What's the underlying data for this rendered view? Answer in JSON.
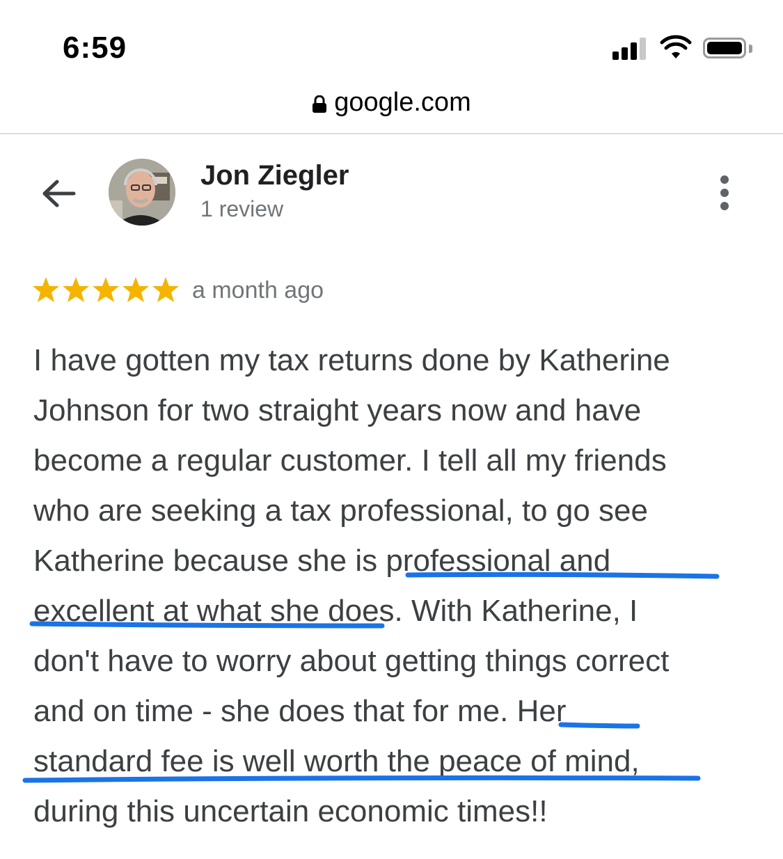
{
  "status_bar": {
    "time": "6:59",
    "icons": [
      "signal-icon",
      "wifi-icon",
      "battery-icon"
    ]
  },
  "browser": {
    "url": "google.com",
    "lock_icon": "lock-icon"
  },
  "reviewer": {
    "name": "Jon Ziegler",
    "review_count": "1 review",
    "avatar": "avatar"
  },
  "review": {
    "rating": 5,
    "max_rating": 5,
    "time": "a month ago",
    "lines": [
      "I have gotten my tax returns done by Katherine",
      "Johnson for two straight years now and have",
      "become a regular customer. I tell all my friends",
      "who are seeking a tax professional, to go see",
      "Katherine because she is professional and",
      "excellent at what she does. With Katherine, I",
      "don't have to worry about getting things correct",
      "and on time - she does that for me. Her",
      "standard fee is well worth the peace of mind,",
      "during this uncertain economic times!!"
    ]
  },
  "colors": {
    "star": "#f4b400",
    "underline": "#1a73e8",
    "text": "#3c4043",
    "secondary_text": "#70757a"
  }
}
